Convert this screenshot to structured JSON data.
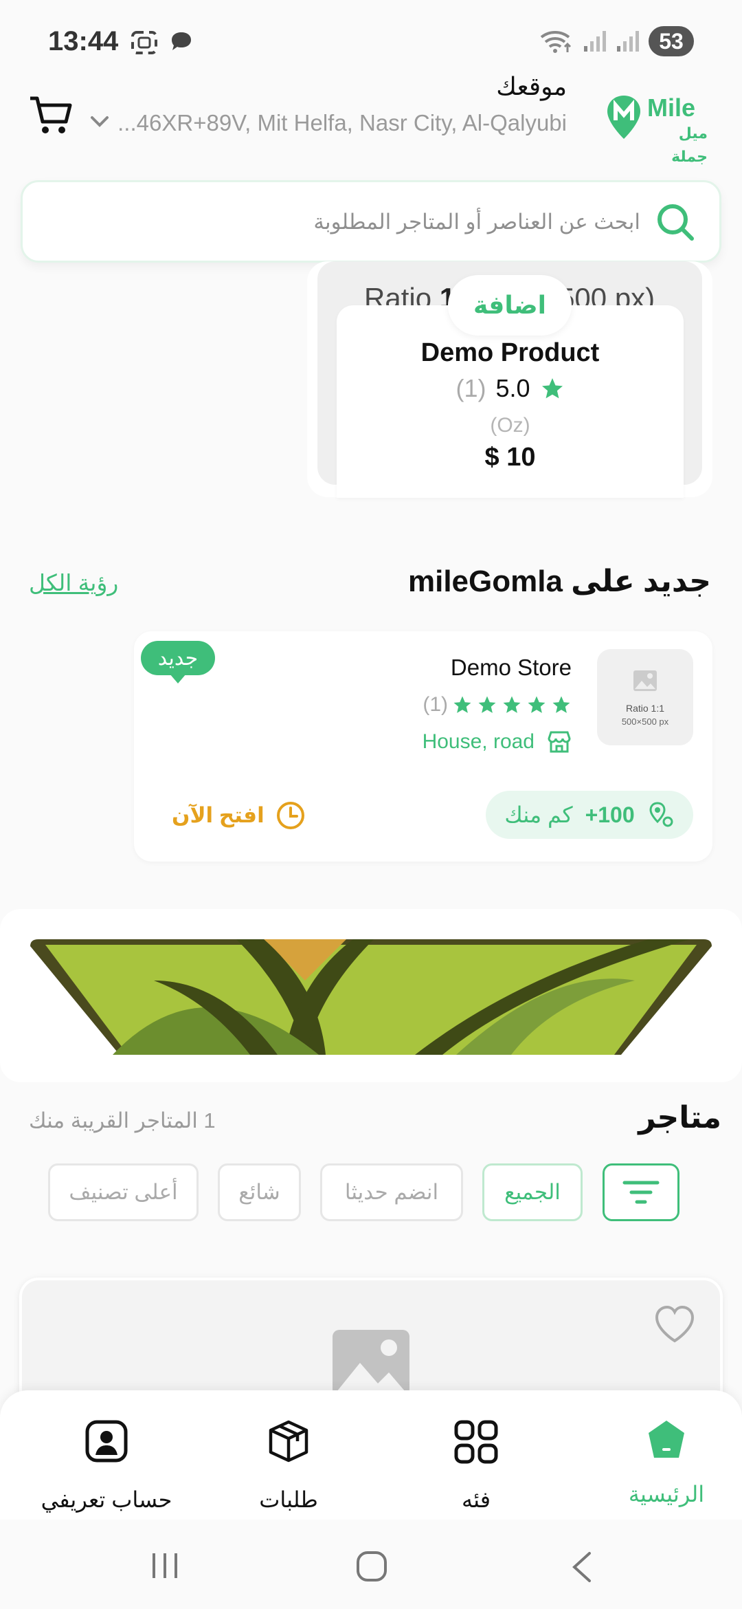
{
  "status_bar": {
    "time": "13:44",
    "battery": "53"
  },
  "header": {
    "location_title": "موقعك",
    "location_address": "...46XR+89V, Mit Helfa, Nasr City, Al-Qalyubi",
    "logo_text": "Mile",
    "logo_subtext": "ميل",
    "logo_subtext2": "جملة"
  },
  "search": {
    "placeholder": "ابحث عن العناصر أو المتاجر المطلوبة"
  },
  "featured_product": {
    "ratio_label": "Ratio ",
    "ratio_value": "1",
    "ratio_suffix": "500 px)",
    "add_label": "اضافة",
    "name": "Demo Product",
    "rating": "5.0",
    "rating_count": "(1)",
    "unit": "(Oz)",
    "price": "$ 10"
  },
  "new_section": {
    "title": "جديد على mileGomla",
    "see_all": "رؤية الكل",
    "store": {
      "name": "Demo Store",
      "rating_count": "(1)",
      "address": "House, road",
      "badge": "جديد",
      "distance_value": "100+",
      "distance_unit": "كم منك",
      "open_status": "افتح الآن",
      "thumb_ratio": "Ratio 1:1",
      "thumb_size": "500×500 px"
    }
  },
  "stores_section": {
    "title": "متاجر",
    "count_text": "1 المتاجر القريبة منك",
    "chips": [
      "الجميع",
      "انضم حديثا",
      "شائع",
      "أعلى تصنيف"
    ]
  },
  "bottom_nav": {
    "items": [
      {
        "label": "الرئيسية",
        "icon": "home-icon",
        "active": true
      },
      {
        "label": "فئه",
        "icon": "grid-icon",
        "active": false
      },
      {
        "label": "طلبات",
        "icon": "box-icon",
        "active": false
      },
      {
        "label": "حساب تعريفي",
        "icon": "profile-icon",
        "active": false
      }
    ]
  },
  "colors": {
    "accent": "#3fbe7a",
    "warning": "#e5a11d",
    "muted": "#9a9a9a"
  }
}
